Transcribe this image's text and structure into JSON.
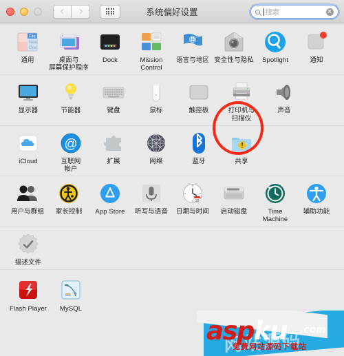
{
  "window": {
    "title": "系统偏好设置",
    "traffic_lights": [
      "close",
      "minimize",
      "zoom"
    ],
    "nav_back_label": "后退",
    "nav_forward_label": "前进",
    "show_all_label": "显示全部"
  },
  "search": {
    "placeholder": "搜索",
    "value": "",
    "icon": "search-icon",
    "clear_icon": "clear-icon"
  },
  "highlight": {
    "target": "打印机与扫描仪",
    "color": "#f42a14",
    "shape": "ellipse"
  },
  "rows": [
    {
      "items": [
        {
          "label": "通用",
          "icon": "general-icon"
        },
        {
          "label": "桌面与\n屏幕保护程序",
          "icon": "desktop-screensaver-icon"
        },
        {
          "label": "Dock",
          "icon": "dock-icon"
        },
        {
          "label": "Mission\nControl",
          "icon": "mission-control-icon"
        },
        {
          "label": "语言与地区",
          "icon": "language-region-icon"
        },
        {
          "label": "安全性与隐私",
          "icon": "security-privacy-icon"
        },
        {
          "label": "Spotlight",
          "icon": "spotlight-icon"
        },
        {
          "label": "通知",
          "icon": "notifications-icon"
        }
      ]
    },
    {
      "items": [
        {
          "label": "显示器",
          "icon": "displays-icon"
        },
        {
          "label": "节能器",
          "icon": "energy-saver-icon"
        },
        {
          "label": "键盘",
          "icon": "keyboard-icon"
        },
        {
          "label": "鼠标",
          "icon": "mouse-icon"
        },
        {
          "label": "触控板",
          "icon": "trackpad-icon"
        },
        {
          "label": "打印机与\n扫描仪",
          "icon": "printers-scanners-icon"
        },
        {
          "label": "声音",
          "icon": "sound-icon"
        }
      ]
    },
    {
      "items": [
        {
          "label": "iCloud",
          "icon": "icloud-icon"
        },
        {
          "label": "互联网\n帐户",
          "icon": "internet-accounts-icon"
        },
        {
          "label": "扩展",
          "icon": "extensions-icon"
        },
        {
          "label": "网络",
          "icon": "network-icon"
        },
        {
          "label": "蓝牙",
          "icon": "bluetooth-icon"
        },
        {
          "label": "共享",
          "icon": "sharing-icon"
        }
      ]
    },
    {
      "items": [
        {
          "label": "用户与群组",
          "icon": "users-groups-icon"
        },
        {
          "label": "家长控制",
          "icon": "parental-controls-icon"
        },
        {
          "label": "App Store",
          "icon": "app-store-icon"
        },
        {
          "label": "听写与语音",
          "icon": "dictation-speech-icon"
        },
        {
          "label": "日期与时间",
          "icon": "date-time-icon"
        },
        {
          "label": "启动磁盘",
          "icon": "startup-disk-icon"
        },
        {
          "label": "Time Machine",
          "icon": "time-machine-icon"
        },
        {
          "label": "辅助功能",
          "icon": "accessibility-icon"
        }
      ]
    },
    {
      "items": [
        {
          "label": "描述文件",
          "icon": "profiles-icon"
        }
      ]
    }
  ],
  "third_party_row": {
    "items": [
      {
        "label": "Flash Player",
        "icon": "flash-player-icon"
      },
      {
        "label": "MySQL",
        "icon": "mysql-icon"
      }
    ]
  },
  "watermark": {
    "brand_1": "asp",
    "brand_2": "ku",
    "domain": ".com",
    "tagline": "免费网站源码下载站",
    "ghost": "网站源码"
  }
}
